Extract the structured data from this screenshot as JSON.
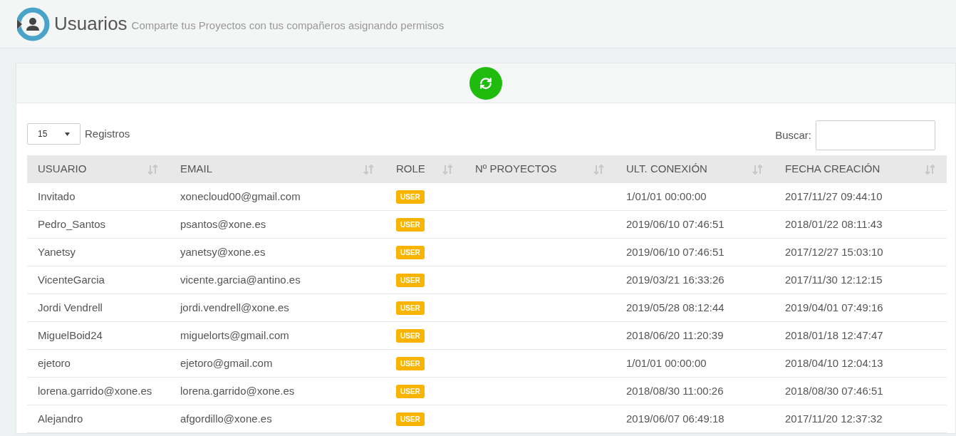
{
  "header": {
    "title": "Usuarios",
    "subtitle": "Comparte tus Proyectos con tus compañeros asignando permisos"
  },
  "length_select": {
    "value": "15",
    "label": "Registros"
  },
  "search": {
    "label": "Buscar:"
  },
  "table": {
    "columns": [
      "USUARIO",
      "EMAIL",
      "ROLE",
      "Nº PROYECTOS",
      "ULT. CONEXIÓN",
      "FECHA CREACIÓN"
    ],
    "rows": [
      {
        "user": "Invitado",
        "email": "xonecloud00@gmail.com",
        "role": "USER",
        "projects": "",
        "last": "1/01/01 00:00:00",
        "created": "2017/11/27 09:44:10"
      },
      {
        "user": "Pedro_Santos",
        "email": "psantos@xone.es",
        "role": "USER",
        "projects": "",
        "last": "2019/06/10 07:46:51",
        "created": "2018/01/22 08:11:43"
      },
      {
        "user": "Yanetsy",
        "email": "yanetsy@xone.es",
        "role": "USER",
        "projects": "",
        "last": "2019/06/10 07:46:51",
        "created": "2017/12/27 15:03:10"
      },
      {
        "user": "VicenteGarcia",
        "email": "vicente.garcia@antino.es",
        "role": "USER",
        "projects": "",
        "last": "2019/03/21 16:33:26",
        "created": "2017/11/30 12:12:15"
      },
      {
        "user": "Jordi Vendrell",
        "email": "jordi.vendrell@xone.es",
        "role": "USER",
        "projects": "",
        "last": "2019/05/28 08:12:44",
        "created": "2019/04/01 07:49:16"
      },
      {
        "user": "MiguelBoid24",
        "email": "miguelorts@gmail.com",
        "role": "USER",
        "projects": "",
        "last": "2018/06/20 11:20:39",
        "created": "2018/01/18 12:47:47"
      },
      {
        "user": "ejetoro",
        "email": "ejetoro@gmail.com",
        "role": "USER",
        "projects": "",
        "last": "1/01/01 00:00:00",
        "created": "2018/04/10 12:04:13"
      },
      {
        "user": "lorena.garrido@xone.es",
        "email": "lorena.garrido@xone.es",
        "role": "USER",
        "projects": "",
        "last": "2018/08/30 11:00:26",
        "created": "2018/08/30 07:46:51"
      },
      {
        "user": "Alejandro",
        "email": "afgordillo@xone.es",
        "role": "USER",
        "projects": "",
        "last": "2019/06/07 06:49:18",
        "created": "2017/11/20 12:37:32"
      }
    ]
  }
}
